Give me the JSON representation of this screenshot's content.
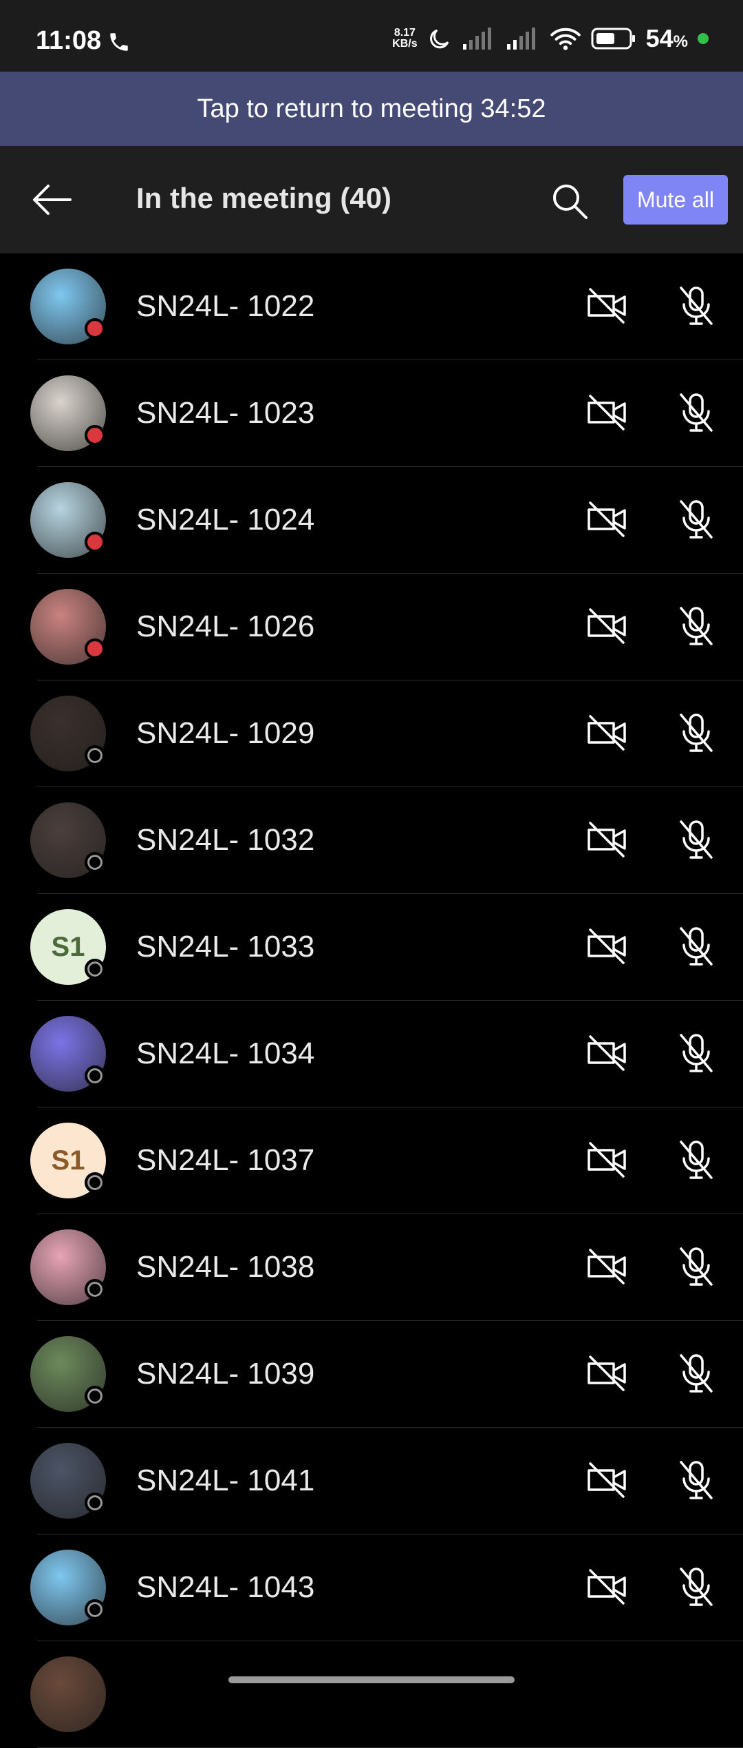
{
  "status_bar": {
    "time": "11:08",
    "net_speed_top": "8.17",
    "net_speed_bottom": "KB/s",
    "battery": "54",
    "battery_unit": "%"
  },
  "banner": {
    "text": "Tap to return to meeting 34:52"
  },
  "header": {
    "title": "In the meeting (40)",
    "mute_all": "Mute all"
  },
  "participants": [
    {
      "name": "SN24L- 1022",
      "status": "busy",
      "avatar": "photo",
      "avatar_color": "#7fc7ef"
    },
    {
      "name": "SN24L- 1023",
      "status": "busy",
      "avatar": "photo",
      "avatar_color": "#d9d3cc"
    },
    {
      "name": "SN24L- 1024",
      "status": "busy",
      "avatar": "photo",
      "avatar_color": "#b6d4e0"
    },
    {
      "name": "SN24L- 1026",
      "status": "busy",
      "avatar": "photo",
      "avatar_color": "#c9837f"
    },
    {
      "name": "SN24L- 1029",
      "status": "offline",
      "avatar": "photo",
      "avatar_color": "#3b302c"
    },
    {
      "name": "SN24L- 1032",
      "status": "offline",
      "avatar": "photo",
      "avatar_color": "#4b3f3c"
    },
    {
      "name": "SN24L- 1033",
      "status": "offline",
      "avatar": "initials",
      "initials": "S1",
      "avatar_color": "#e3efd9",
      "initials_color": "#4d6b3a"
    },
    {
      "name": "SN24L- 1034",
      "status": "offline",
      "avatar": "photo",
      "avatar_color": "#7b74e6"
    },
    {
      "name": "SN24L- 1037",
      "status": "offline",
      "avatar": "initials",
      "initials": "S1",
      "avatar_color": "#fde6cf",
      "initials_color": "#8a5a2a"
    },
    {
      "name": "SN24L- 1038",
      "status": "offline",
      "avatar": "photo",
      "avatar_color": "#e7a4b6"
    },
    {
      "name": "SN24L- 1039",
      "status": "offline",
      "avatar": "photo",
      "avatar_color": "#6d8a5c"
    },
    {
      "name": "SN24L- 1041",
      "status": "offline",
      "avatar": "photo",
      "avatar_color": "#4c5566"
    },
    {
      "name": "SN24L- 1043",
      "status": "offline",
      "avatar": "photo",
      "avatar_color": "#7fc7ef"
    },
    {
      "name": "",
      "status": "",
      "avatar": "photo",
      "avatar_color": "#6a4a3a"
    }
  ]
}
